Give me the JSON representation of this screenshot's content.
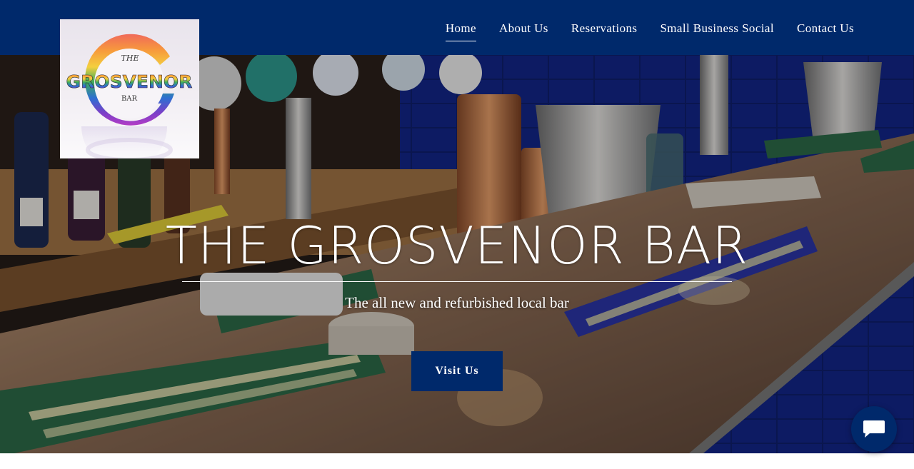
{
  "logo": {
    "word_the": "THE",
    "word_main": "GROSVENOR",
    "word_bar": "BAR"
  },
  "nav": {
    "items": [
      {
        "label": "Home",
        "active": true
      },
      {
        "label": "About Us",
        "active": false
      },
      {
        "label": "Reservations",
        "active": false
      },
      {
        "label": "Small Business Social",
        "active": false
      },
      {
        "label": "Contact Us",
        "active": false
      }
    ]
  },
  "hero": {
    "title": "THE GROSVENOR BAR",
    "subtitle": "The all new and refurbished local bar",
    "cta_label": "Visit Us",
    "background": "bar-counter-photo"
  },
  "chat": {
    "icon": "chat-bubble-icon"
  },
  "colors": {
    "brand_navy": "#00296b",
    "text_white": "#ffffff"
  }
}
